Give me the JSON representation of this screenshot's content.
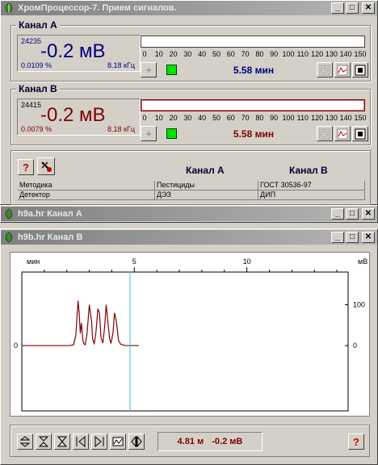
{
  "main_window": {
    "title": "ХромПроцессор-7. Прием сигналов."
  },
  "channel_a": {
    "label": "Канал А",
    "count": "24235",
    "value": "-0.2 мВ",
    "percent": "0.0109 %",
    "freq": "8.18 кГц",
    "time": "5.58 мин",
    "scale_ticks": [
      "0",
      "10",
      "20",
      "30",
      "40",
      "50",
      "60",
      "70",
      "80",
      "90",
      "100",
      "110",
      "120",
      "130",
      "140",
      "150"
    ]
  },
  "channel_b": {
    "label": "Канал В",
    "count": "24415",
    "value": "-0.2 мВ",
    "percent": "0.0079 %",
    "freq": "8.18 кГц",
    "time": "5.58 мин",
    "scale_ticks": [
      "0",
      "10",
      "20",
      "30",
      "40",
      "50",
      "60",
      "70",
      "80",
      "90",
      "100",
      "110",
      "120",
      "130",
      "140",
      "150"
    ]
  },
  "info": {
    "help_label": "?",
    "col_a": "Канал А",
    "col_b": "Канал В",
    "rows": [
      {
        "name": "Методика",
        "a": "Пестициды",
        "b": "ГОСТ 30536-97"
      },
      {
        "name": "Детектор",
        "a": "ДЭЗ",
        "b": "ДИП"
      }
    ]
  },
  "window_a": {
    "title": "h9a.hr Канал А"
  },
  "window_b": {
    "title": "h9b.hr Канал В"
  },
  "title_buttons": {
    "minimize": "_",
    "maximize": "□",
    "close": "✕"
  },
  "chart_data": {
    "type": "line",
    "xlabel": "мин",
    "ylabel": "мВ",
    "x_ticks": [
      "5",
      "10"
    ],
    "xlim": [
      0,
      14.5
    ],
    "y_ticks_right": [
      "100",
      "0"
    ],
    "y_ticks_left": [
      "0"
    ],
    "ylim": [
      -160,
      180
    ],
    "cursor_x": 4.81,
    "line_color": "#800000",
    "cursor_color": "#40c0d0",
    "series": [
      {
        "x": [
          0,
          1.0,
          2.1,
          2.3,
          2.4,
          2.5,
          2.55,
          2.6,
          2.65,
          2.72,
          2.78,
          2.82,
          2.9,
          3.0,
          3.1,
          3.15,
          3.22,
          3.3,
          3.38,
          3.45,
          3.52,
          3.6,
          3.68,
          3.75,
          3.82,
          3.9,
          3.96,
          4.05,
          4.12,
          4.2,
          4.3,
          4.4,
          4.6,
          5.2
        ],
        "y": [
          0,
          0,
          0,
          2,
          25,
          110,
          80,
          30,
          55,
          10,
          3,
          2,
          30,
          100,
          60,
          15,
          5,
          35,
          90,
          80,
          20,
          6,
          45,
          100,
          60,
          18,
          5,
          30,
          80,
          60,
          12,
          3,
          0,
          0
        ]
      }
    ]
  },
  "status": {
    "position": "4.81 м",
    "value": "-0.2 мВ"
  },
  "colors": {
    "led_on": "#00e000",
    "channel_a": "#000080",
    "channel_b": "#800000"
  }
}
